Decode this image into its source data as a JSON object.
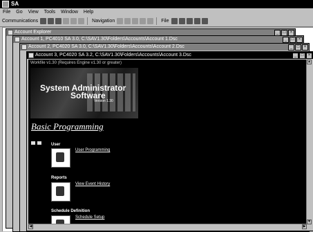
{
  "app": {
    "title": "SA"
  },
  "menu": [
    "File",
    "Go",
    "View",
    "Tools",
    "Window",
    "Help"
  ],
  "toolbar": {
    "communications_label": "Communications",
    "navigation_label": "Navigation",
    "file_label": "File"
  },
  "windows": {
    "explorer": {
      "title": "Account Explorer"
    },
    "account1": {
      "title": "Account 1, PC4010 SA 3.0, C:\\SAV1.30\\Folders\\Accounts\\Account 1.Dsc"
    },
    "account2": {
      "title": "Account 2, PC4020 SA 3.0, C:\\SAV1.30\\Folders\\Accounts\\Account 2.Dsc"
    },
    "account3": {
      "title": "Account 3, PC4020 SA 3.2, C:\\SAV1.30\\Folders\\Accounts\\Account 3.Dsc"
    }
  },
  "content": {
    "hint": "Workfile v1.30 (Requires Engine v1.30 or greater)",
    "banner": {
      "line1": "System Administrator",
      "line2": "Software",
      "version": "Version 1.30"
    },
    "heading": "Basic Programming",
    "sections": [
      {
        "title": "User",
        "link": "User Programming"
      },
      {
        "title": "Reports",
        "link": "View Event History"
      },
      {
        "title": "Schedule Definition",
        "link": "Schedule Setup"
      }
    ]
  },
  "colors": {
    "mdi_bg": "#ffffff",
    "active_title": "#000000",
    "inactive_title": "#808080"
  }
}
